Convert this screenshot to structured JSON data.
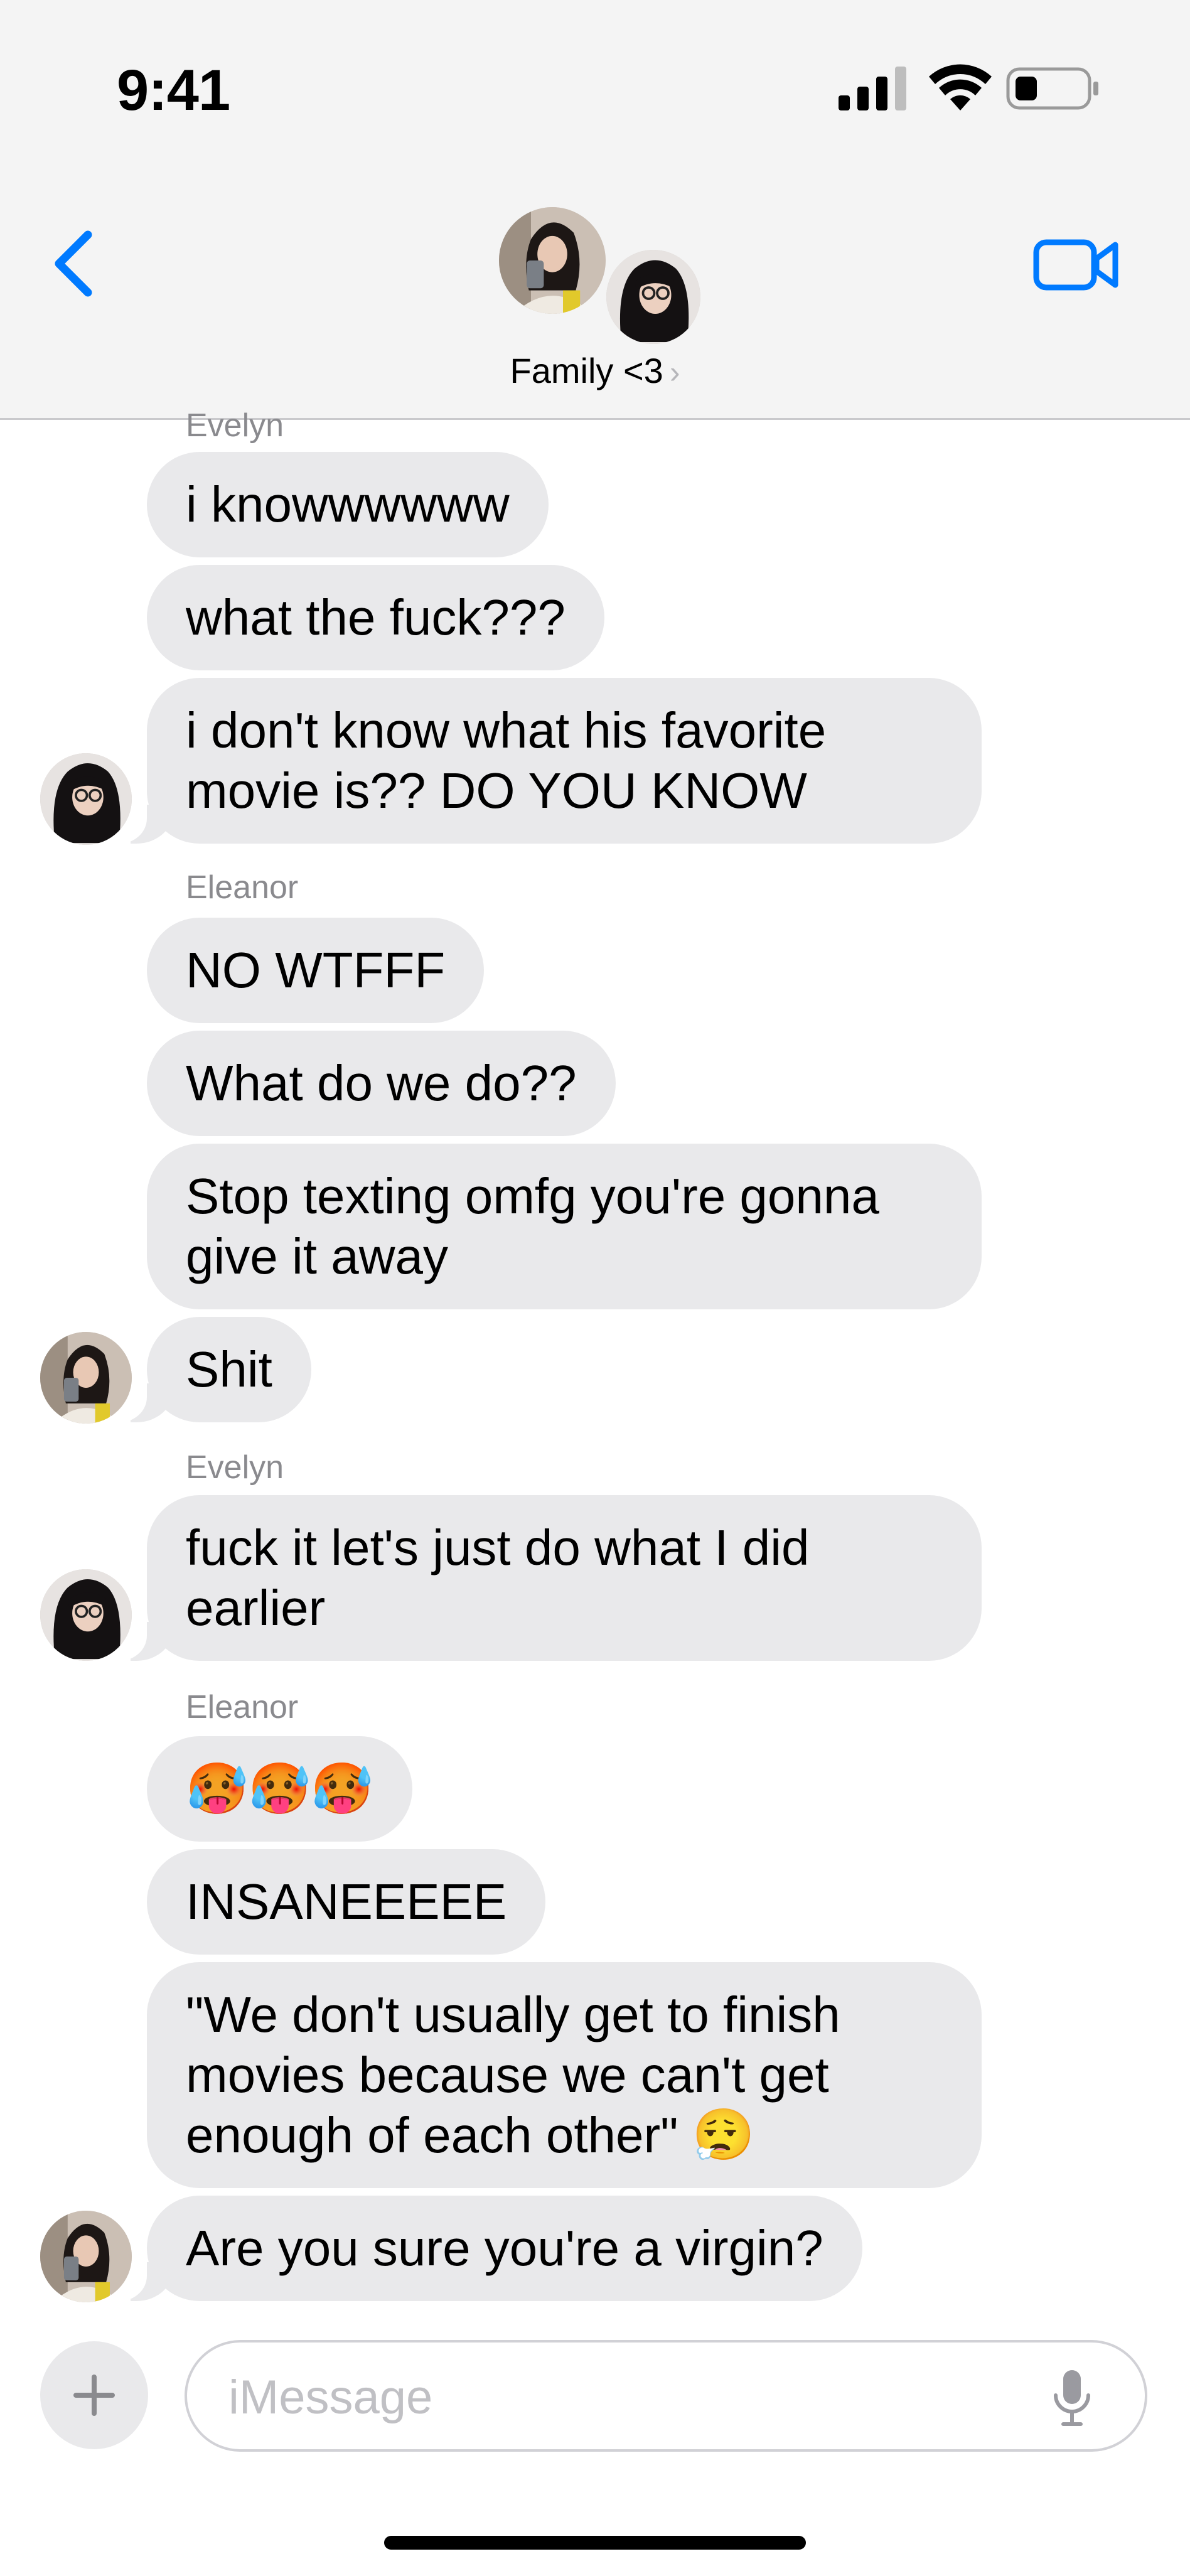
{
  "status_bar": {
    "time": "9:41",
    "icons": [
      "cellular-signal-icon",
      "wifi-icon",
      "battery-icon"
    ]
  },
  "header": {
    "back_icon": "chevron-left-icon",
    "group_name": "Family <3",
    "group_chevron": "›",
    "video_icon": "video-camera-icon"
  },
  "messages": [
    {
      "sender": "Evelyn",
      "text": "i knowwwwww"
    },
    {
      "sender": "Evelyn",
      "text": "what the fuck???"
    },
    {
      "sender": "Evelyn",
      "text": "i don't know what his favorite\nmovie is?? DO YOU KNOW"
    },
    {
      "sender": "Eleanor",
      "text": "NO WTFFF"
    },
    {
      "sender": "Eleanor",
      "text": "What do we do??"
    },
    {
      "sender": "Eleanor",
      "text": "Stop texting omfg you're gonna\ngive it away"
    },
    {
      "sender": "Eleanor",
      "text": "Shit"
    },
    {
      "sender": "Evelyn",
      "text": "fuck it let's just do what I did\nearlier"
    },
    {
      "sender": "Eleanor",
      "text": "🥵🥵🥵"
    },
    {
      "sender": "Eleanor",
      "text": "INSANEEEEE"
    },
    {
      "sender": "Eleanor",
      "text": "\"We don't usually get to finish\nmovies because we can't get\nenough of each other\" 😮‍💨"
    },
    {
      "sender": "Eleanor",
      "text": "Are you sure you're a virgin?"
    }
  ],
  "sender_labels": {
    "evelyn_1": "Evelyn",
    "eleanor_1": "Eleanor",
    "evelyn_2": "Evelyn",
    "eleanor_2": "Eleanor"
  },
  "compose": {
    "placeholder": "iMessage",
    "plus_icon": "plus-icon",
    "mic_icon": "microphone-icon"
  },
  "colors": {
    "accent": "#007aff",
    "bubble_gray": "#e9e9eb",
    "header_bg": "#f4f4f4",
    "sender_label": "#8a8a8e"
  }
}
